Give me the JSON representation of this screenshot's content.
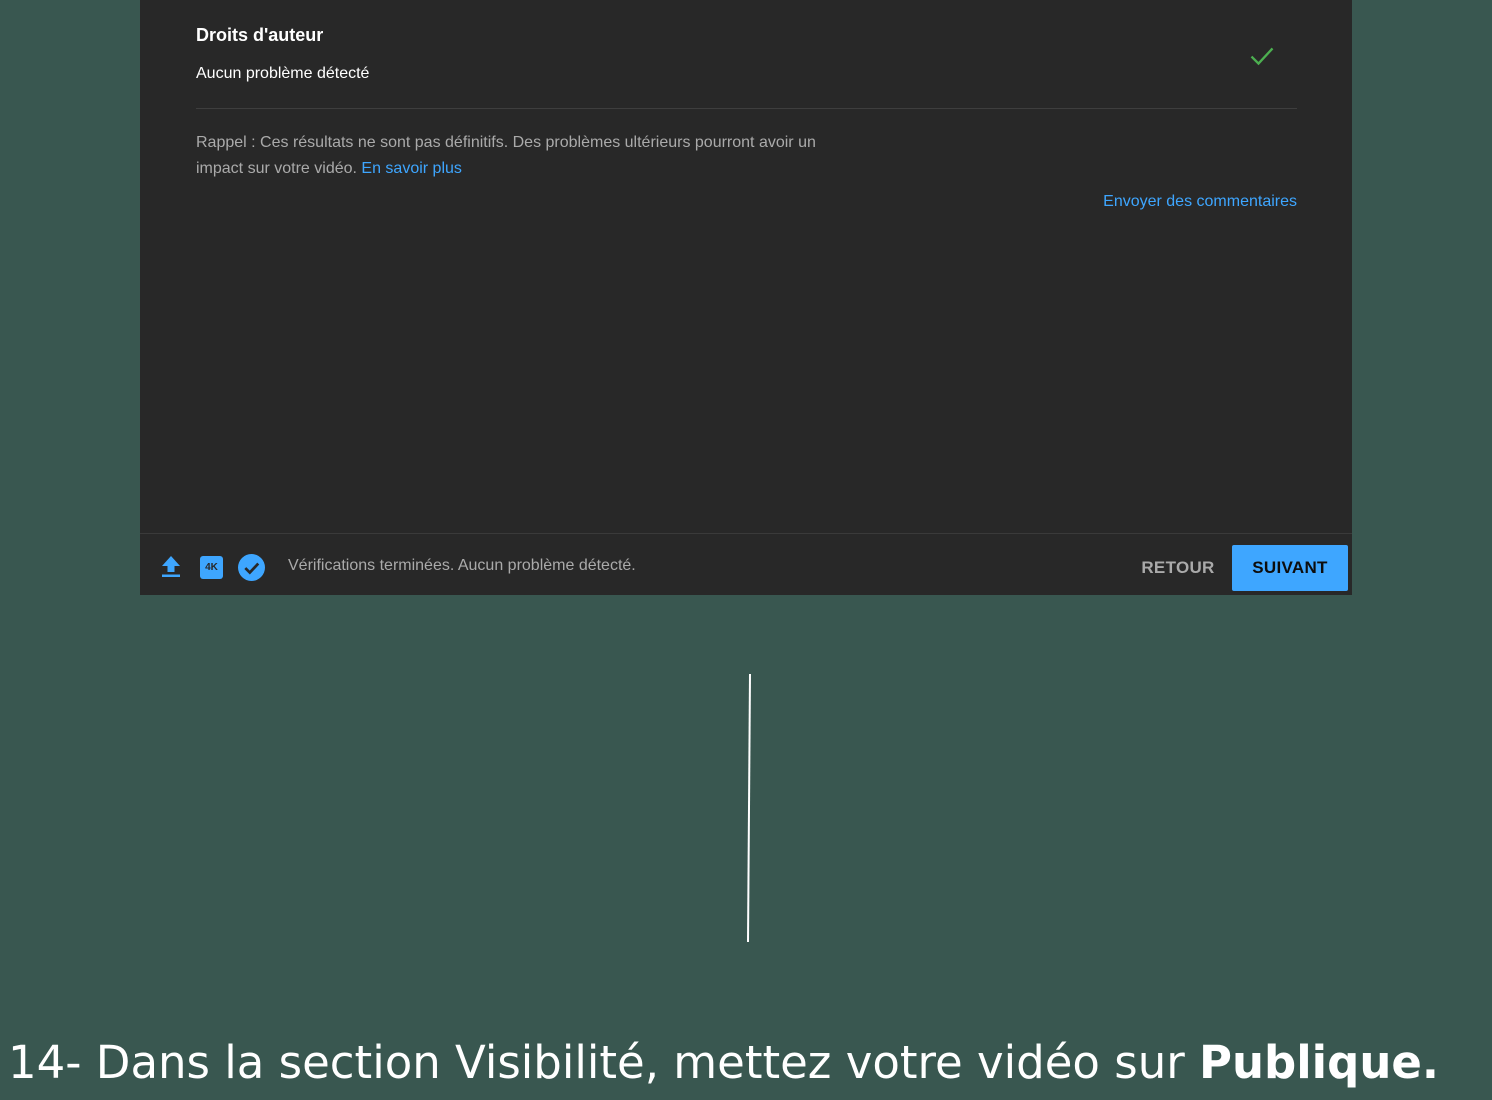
{
  "copyright": {
    "title": "Droits d'auteur",
    "status": "Aucun problème détecté",
    "status_icon": "check-icon",
    "status_color": "#4caf50"
  },
  "note": {
    "text": "Rappel : Ces résultats ne sont pas définitifs. Des problèmes ultérieurs pourront avoir un impact sur votre vidéo.",
    "link": "En savoir plus"
  },
  "feedback_link": "Envoyer des commentaires",
  "footer": {
    "icons": [
      "upload-icon",
      "4k-icon",
      "checks-done-icon"
    ],
    "hd_badge": "4K",
    "status": "Vérifications terminées. Aucun problème détecté.",
    "back_label": "RETOUR",
    "next_label": "SUIVANT"
  },
  "caption": {
    "prefix": "14- Dans la section Visibilité, mettez votre vidéo sur ",
    "bold": "Publique."
  },
  "colors": {
    "background": "#395750",
    "panel": "#282828",
    "accent": "#3ea6ff"
  }
}
